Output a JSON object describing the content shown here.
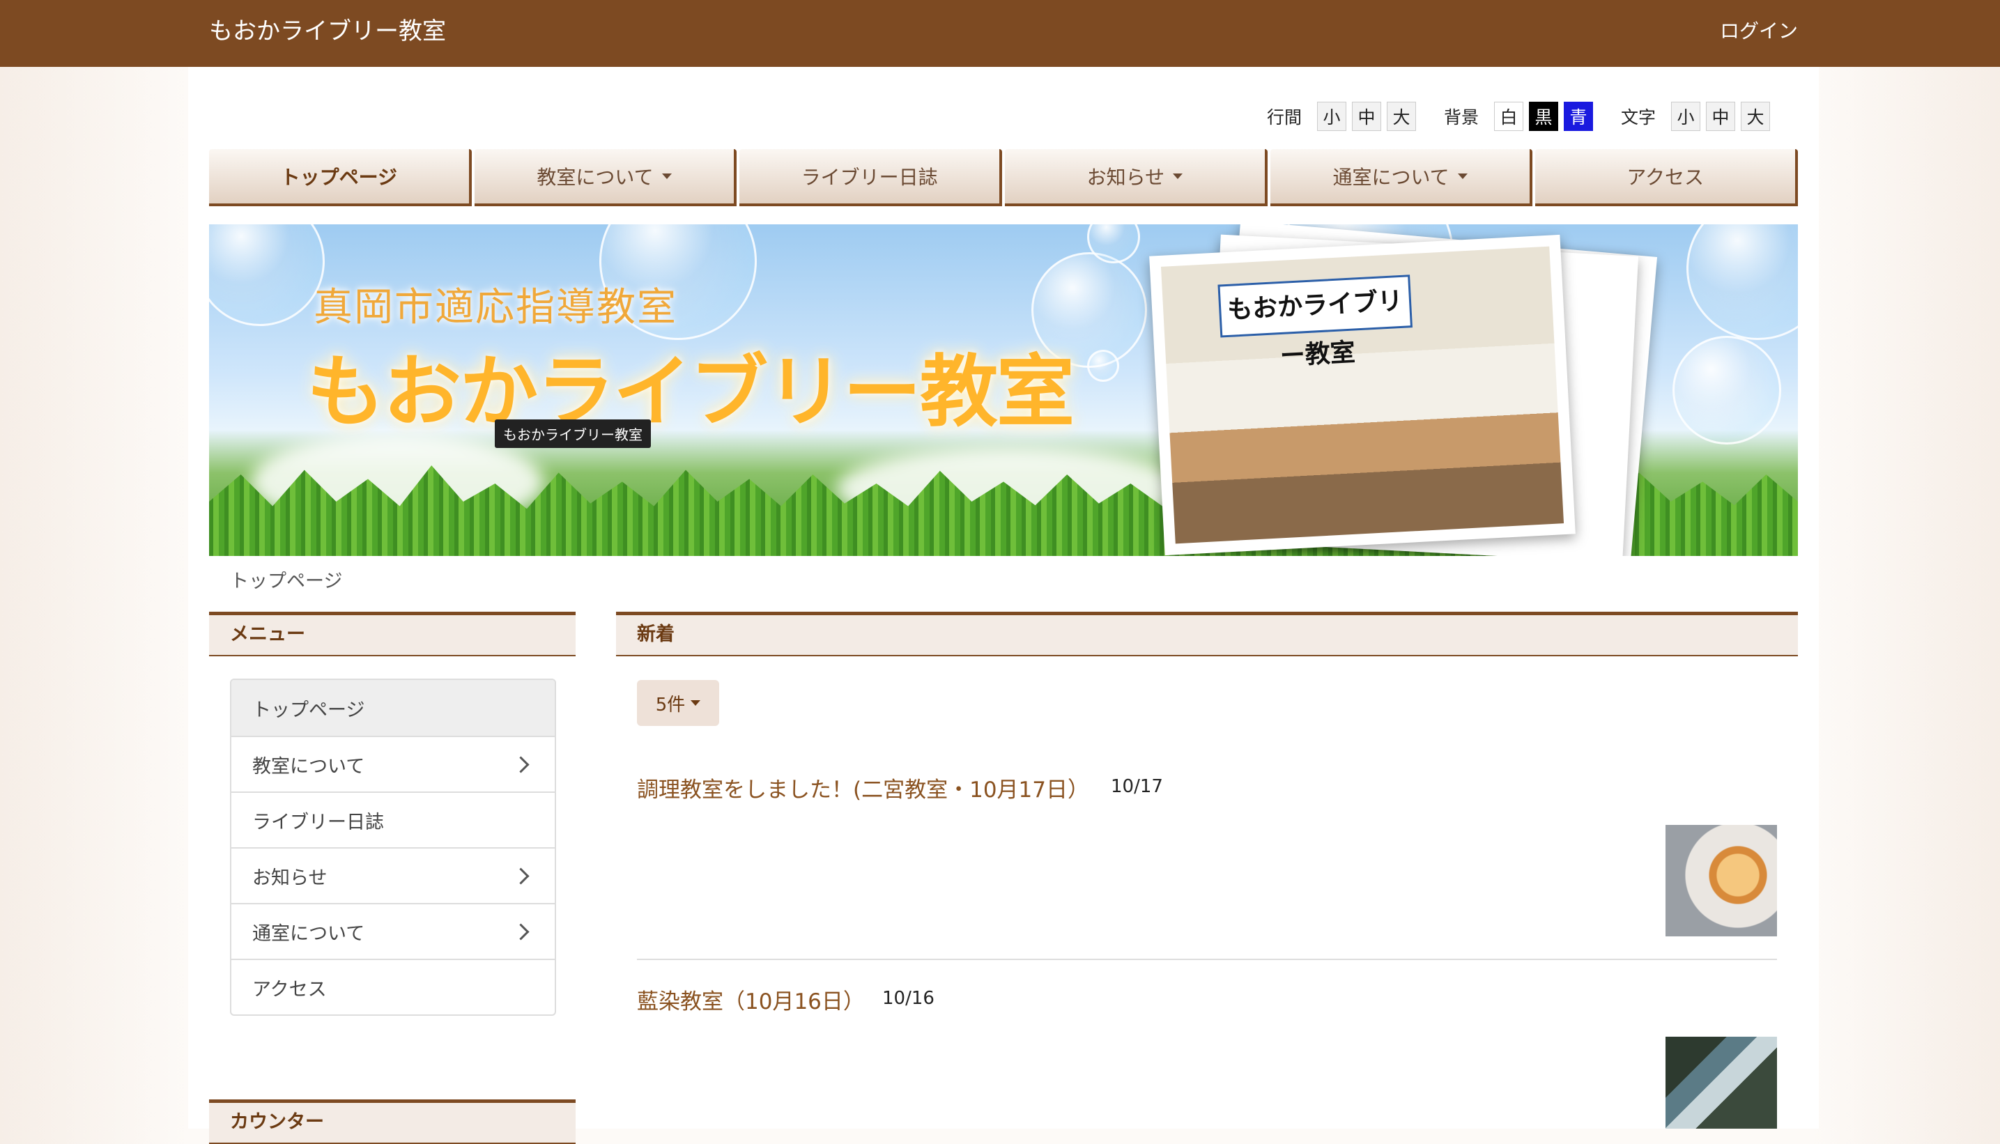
{
  "header": {
    "site_title": "もおかライブリー教室",
    "login": "ログイン"
  },
  "accessibility": {
    "line_spacing_label": "行間",
    "background_label": "背景",
    "text_label": "文字",
    "size_small": "小",
    "size_medium": "中",
    "size_large": "大",
    "bg_white": "白",
    "bg_black": "黒",
    "bg_blue": "青"
  },
  "nav": [
    {
      "label": "トップページ",
      "dropdown": false,
      "active": true
    },
    {
      "label": "教室について",
      "dropdown": true
    },
    {
      "label": "ライブリー日誌",
      "dropdown": false
    },
    {
      "label": "お知らせ",
      "dropdown": true
    },
    {
      "label": "通室について",
      "dropdown": true
    },
    {
      "label": "アクセス",
      "dropdown": false
    }
  ],
  "banner": {
    "subtitle": "真岡市適応指導教室",
    "title": "もおかライブリー教室",
    "tooltip": "もおかライブリー教室",
    "photo_sign": "もおかライブリー教室"
  },
  "breadcrumb": "トップページ",
  "sidebar": {
    "menu_heading": "メニュー",
    "items": [
      {
        "label": "トップページ",
        "has_children": false
      },
      {
        "label": "教室について",
        "has_children": true
      },
      {
        "label": "ライブリー日誌",
        "has_children": false
      },
      {
        "label": "お知らせ",
        "has_children": true
      },
      {
        "label": "通室について",
        "has_children": true
      },
      {
        "label": "アクセス",
        "has_children": false
      }
    ],
    "counter_heading": "カウンター"
  },
  "main": {
    "heading": "新着",
    "count_button": "5件",
    "news": [
      {
        "title": "調理教室をしました！(二宮教室・10月17日）",
        "date": "10/17"
      },
      {
        "title": "藍染教室（10月16日）",
        "date": "10/16"
      }
    ]
  },
  "colors": {
    "brand": "#7d4a22",
    "link": "#8a5220",
    "accent_blue": "#1a1adf"
  }
}
